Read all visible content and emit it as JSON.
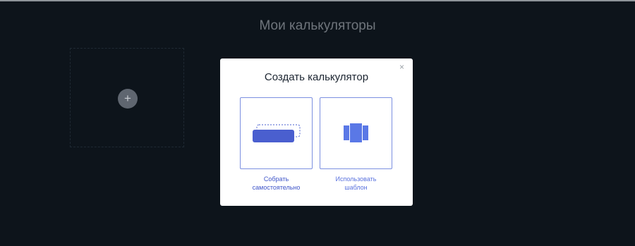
{
  "page": {
    "title": "Мои калькуляторы",
    "add_icon": "plus-icon"
  },
  "modal": {
    "title": "Создать калькулятор",
    "close_icon": "close-icon",
    "close_glyph": "×",
    "options": [
      {
        "line1": "Собрать",
        "line2": "самостоятельно",
        "icon": "build-yourself-icon"
      },
      {
        "line1": "Использовать",
        "line2": "шаблон",
        "icon": "template-icon"
      }
    ]
  },
  "colors": {
    "background": "#0d141b",
    "accent": "#3f55c9",
    "accent_light": "#5a72de",
    "border": "#7b8fe0"
  }
}
